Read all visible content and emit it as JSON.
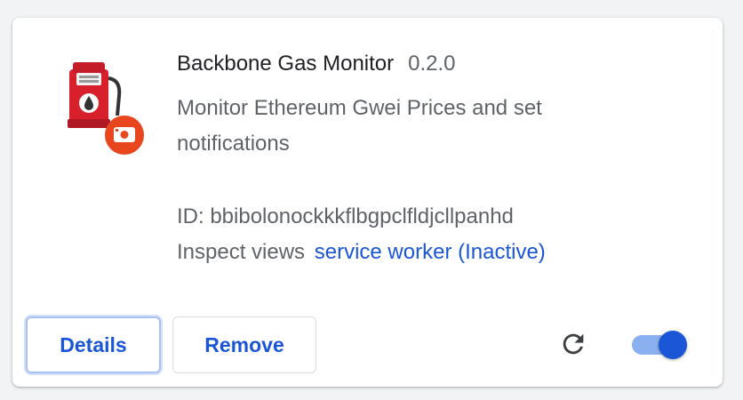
{
  "extension": {
    "name": "Backbone Gas Monitor",
    "version": "0.2.0",
    "description": "Monitor Ethereum Gwei Prices and set notifications",
    "id_label": "ID: bbibolonockkkflbgpclfldjcllpanhd",
    "inspect_label": "Inspect views",
    "inspect_link": "service worker (Inactive)",
    "icon": "gas-pump-icon",
    "enabled": true
  },
  "actions": {
    "details_label": "Details",
    "remove_label": "Remove",
    "reload_icon": "reload-icon"
  },
  "colors": {
    "accent": "#1a56d6",
    "toggle_track": "#8ab0f0",
    "pump_red": "#d8202c",
    "badge_orange": "#e8461f"
  }
}
